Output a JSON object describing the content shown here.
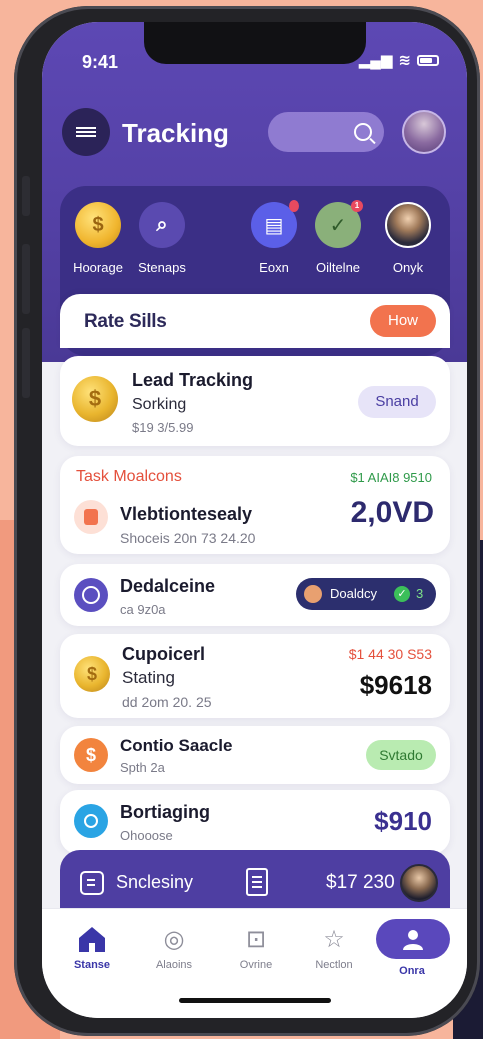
{
  "status": {
    "time": "9:41",
    "signal": "▂▄▆",
    "wifi": "≋"
  },
  "header": {
    "title": "Tracking"
  },
  "quick_actions": [
    {
      "label": "Hoorage",
      "icon": "dollar-coin-icon",
      "glyph": "$",
      "color": "#f2b632"
    },
    {
      "label": "Stenaps",
      "icon": "search-icon",
      "glyph": "⌕",
      "color": "#5a4ab0"
    },
    {
      "label": "Eoxn",
      "icon": "chat-icon",
      "glyph": "▤",
      "color": "#5b5fe8",
      "badge": ""
    },
    {
      "label": "Oiltelne",
      "icon": "check-icon",
      "glyph": "✓",
      "color": "#8ab07a",
      "badge": "1"
    },
    {
      "label": "Onyk",
      "icon": "person-avatar",
      "glyph": "",
      "color": "#ffffff"
    }
  ],
  "rate_bar": {
    "title": "Rate Sills",
    "button": "How"
  },
  "cards": {
    "lead": {
      "title": "Lead Tracking",
      "subtitle": "Sorking",
      "detail": "$19 3/5.99",
      "pill": "Snand"
    },
    "task": {
      "label": "Task Moalcons",
      "amount_small": "$1 AIAI8 9510",
      "title": "Vlebtiontesealy",
      "detail": "Shoceis 20n 73 24.20",
      "amount": "2,0VD"
    },
    "deadline": {
      "title": "Dedalceine",
      "detail": "ca 9z0a",
      "pill": "Doaldcy",
      "pill_badge": "3"
    },
    "cupcicerl": {
      "title": "Cupoicerl",
      "subtitle": "Stating",
      "detail": "dd 2om 20. 25",
      "amount_small": "$1 44 30 S53",
      "amount": "$9618"
    },
    "contio": {
      "title": "Contio Saacle",
      "detail": "Spth 2a",
      "pill": "Svtado"
    },
    "bortiaging": {
      "title": "Bortiaging",
      "detail": "Ohooose",
      "amount": "$910"
    }
  },
  "bottom_bar": {
    "label": "Snclesiny",
    "amount": "$17 230"
  },
  "tabs": [
    {
      "label": "Stanse",
      "icon": "home-icon",
      "glyph": "⌂"
    },
    {
      "label": "Alaoins",
      "icon": "check-circle-icon",
      "glyph": "◎"
    },
    {
      "label": "Ovrine",
      "icon": "document-icon",
      "glyph": "⊡"
    },
    {
      "label": "Nectlon",
      "icon": "star-icon",
      "glyph": "☆"
    },
    {
      "label": "Onra",
      "icon": "profile-icon",
      "glyph": "●"
    }
  ],
  "colors": {
    "accent": "#5340a4",
    "orange": "#f2734e",
    "green": "#2f9a4a",
    "red": "#e4503c"
  }
}
